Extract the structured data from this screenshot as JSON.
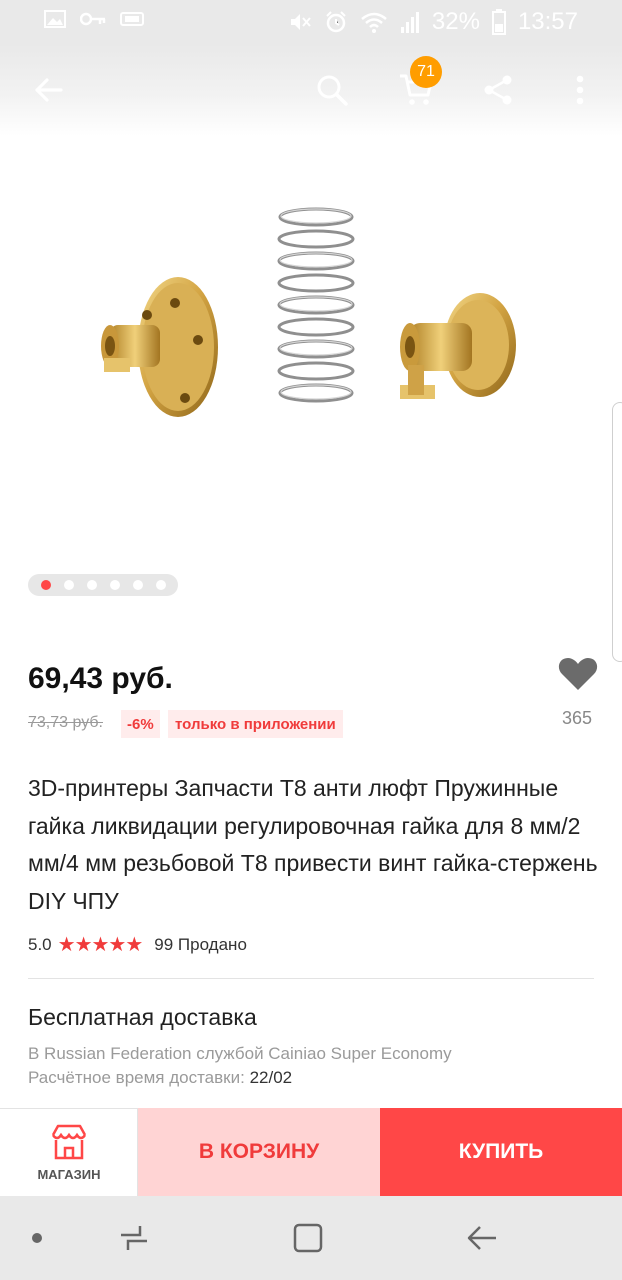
{
  "status_bar": {
    "battery": "32%",
    "time": "13:57",
    "icons": [
      "gallery-icon",
      "key-icon",
      "sim-icon",
      "mute-icon",
      "alarm-icon",
      "wifi-icon",
      "signal-icon",
      "battery-icon"
    ]
  },
  "top_bar": {
    "icons": [
      "back-arrow-icon",
      "search-icon",
      "cart-icon",
      "share-icon",
      "more-icon"
    ],
    "cart_count": "71"
  },
  "gallery": {
    "total_images": 6,
    "active_index": 1
  },
  "product": {
    "price": "69,43 руб.",
    "old_price": "73,73 руб.",
    "discount": "-6%",
    "app_only": "только в приложении",
    "favorites": "365",
    "title": "3D-принтеры Запчасти T8 анти люфт Пружинные гайка ликвидации регулировочная гайка для 8 мм/2 мм/4 мм резьбовой T8 привести винт гайка-стержень DIY ЧПУ",
    "rating": "5.0",
    "stars": "★★★★★",
    "sold": "99 Продано"
  },
  "shipping": {
    "title": "Бесплатная доставка",
    "method": "В Russian Federation службой Cainiao Super Economy",
    "estimate_label": "Расчётное время доставки:",
    "estimate_date": "22/02"
  },
  "actions": {
    "store_label": "МАГАЗИН",
    "add_to_cart": "В КОРЗИНУ",
    "buy_now": "КУПИТЬ"
  },
  "colors": {
    "accent": "#ff4747",
    "badge": "#ff9d00",
    "light_accent": "#ffd4d4"
  }
}
